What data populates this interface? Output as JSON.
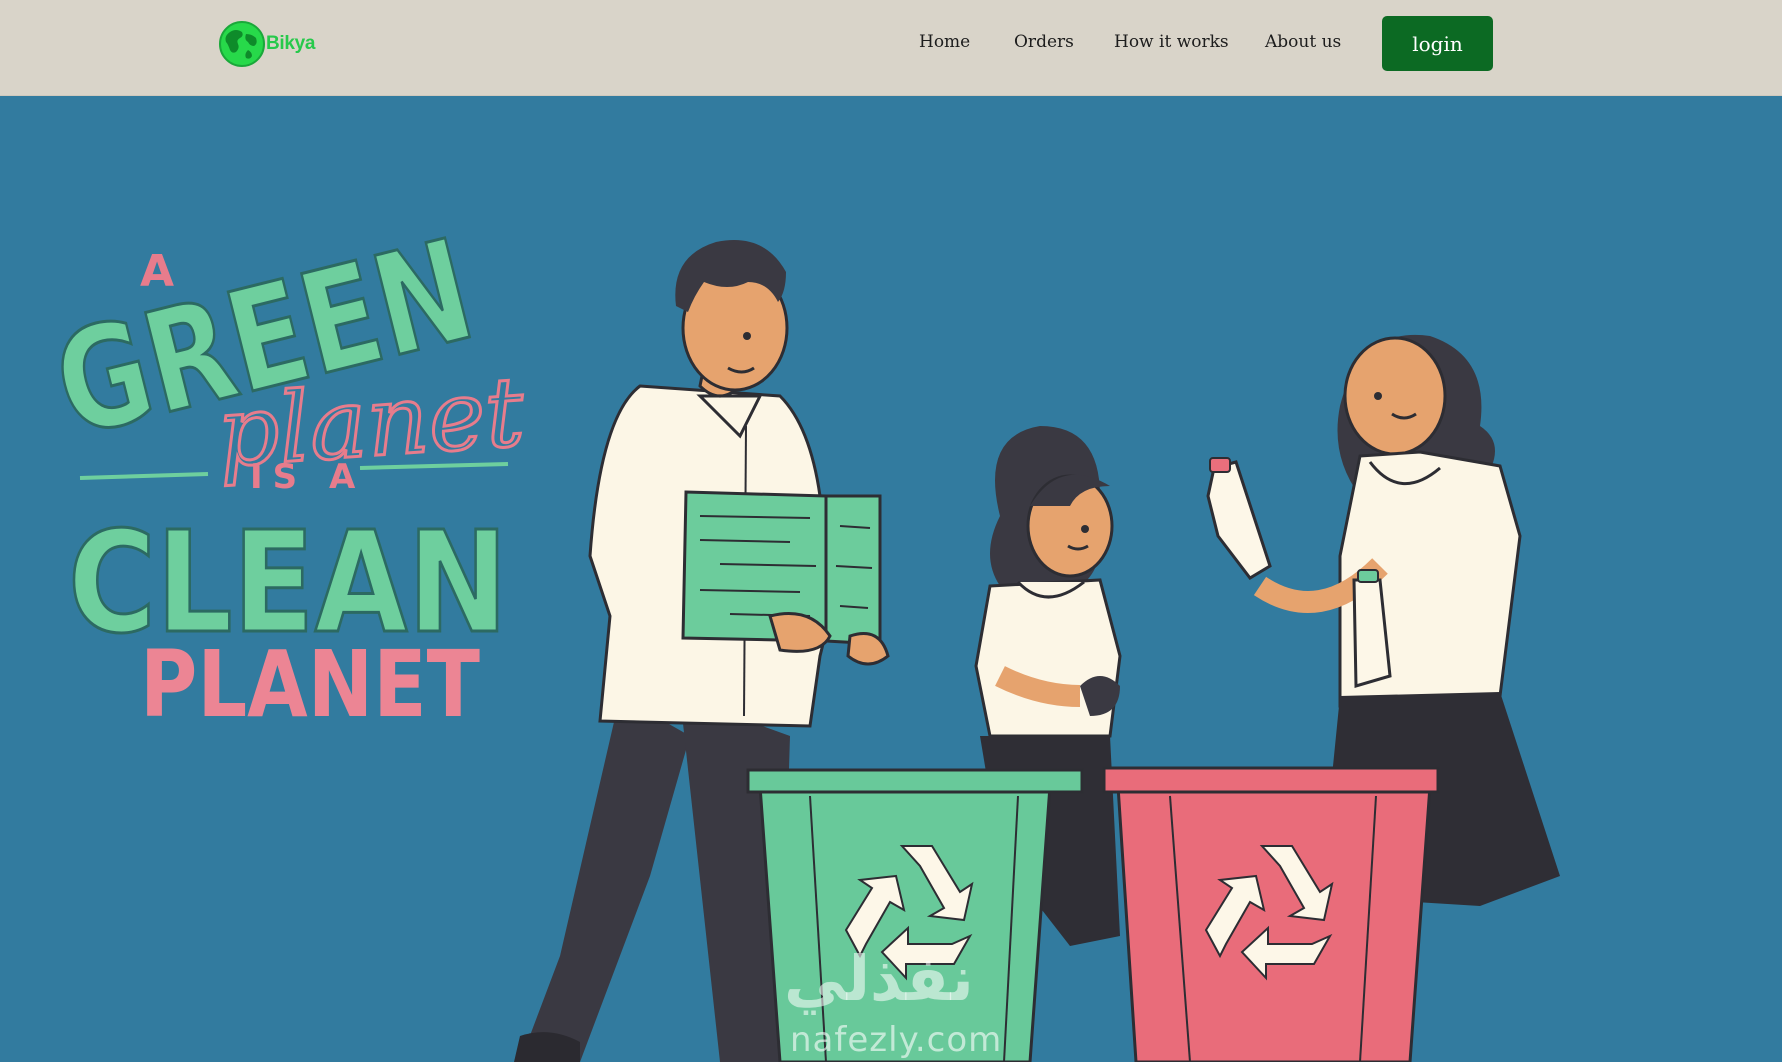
{
  "header": {
    "brand": "Bikya",
    "nav": [
      {
        "label": "Home"
      },
      {
        "label": "Orders"
      },
      {
        "label": "How it works"
      },
      {
        "label": "About us"
      }
    ],
    "login_label": "login",
    "colors": {
      "background": "#d9d4c9",
      "login_bg": "#0c6a23",
      "brand": "#27c94b"
    }
  },
  "hero": {
    "background": "#327b9f",
    "slogan": {
      "line1": "A",
      "line2": "GREEN",
      "line3": "planet",
      "line4": "IS A",
      "line5": "CLEAN",
      "line6": "PLANET"
    },
    "watermark": {
      "arabic": "نفذلي",
      "url": "nafezly.com"
    }
  },
  "icons": {
    "logo": "globe-icon",
    "recycle": "recycle-icon"
  }
}
